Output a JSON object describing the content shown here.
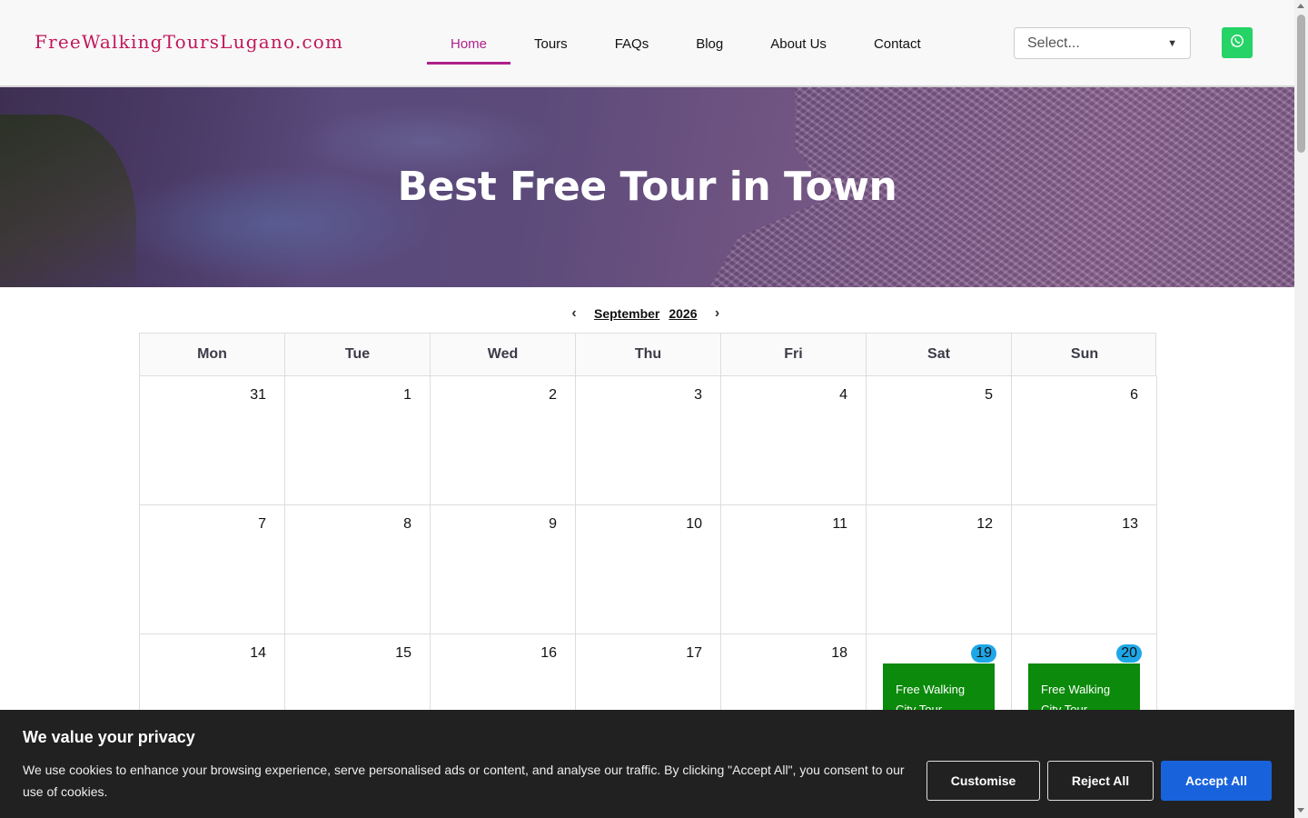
{
  "header": {
    "logo": "FreeWalkingToursLugano.com",
    "nav": [
      {
        "label": "Home",
        "active": true
      },
      {
        "label": "Tours",
        "active": false
      },
      {
        "label": "FAQs",
        "active": false
      },
      {
        "label": "Blog",
        "active": false
      },
      {
        "label": "About Us",
        "active": false
      },
      {
        "label": "Contact",
        "active": false
      }
    ],
    "language_select": "Select...",
    "whatsapp_icon": "whatsapp-icon"
  },
  "hero": {
    "title": "Best Free Tour in Town"
  },
  "calendar": {
    "month": "September",
    "year": "2026",
    "weekdays": [
      "Mon",
      "Tue",
      "Wed",
      "Thu",
      "Fri",
      "Sat",
      "Sun"
    ],
    "weeks": [
      [
        "31",
        "1",
        "2",
        "3",
        "4",
        "5",
        "6"
      ],
      [
        "7",
        "8",
        "9",
        "10",
        "11",
        "12",
        "13"
      ],
      [
        "14",
        "15",
        "16",
        "17",
        "18",
        "19",
        "20"
      ]
    ],
    "highlighted_days": [
      "19",
      "20"
    ],
    "events": [
      {
        "day": "19",
        "label": "Free Walking City Tour"
      },
      {
        "day": "20",
        "label": "Free Walking City Tour"
      }
    ]
  },
  "cookie_banner": {
    "title": "We value your privacy",
    "text": "We use cookies to enhance your browsing experience, serve personalised ads or content, and analyse our traffic. By clicking \"Accept All\", you consent to our use of cookies.",
    "customise": "Customise",
    "reject": "Reject All",
    "accept": "Accept All"
  },
  "colors": {
    "accent": "#b0208a",
    "logo": "#c2185b",
    "event": "#0b8a0b",
    "highlight": "#1ea7e8",
    "accept_button": "#1863dc",
    "whatsapp": "#25d366"
  }
}
